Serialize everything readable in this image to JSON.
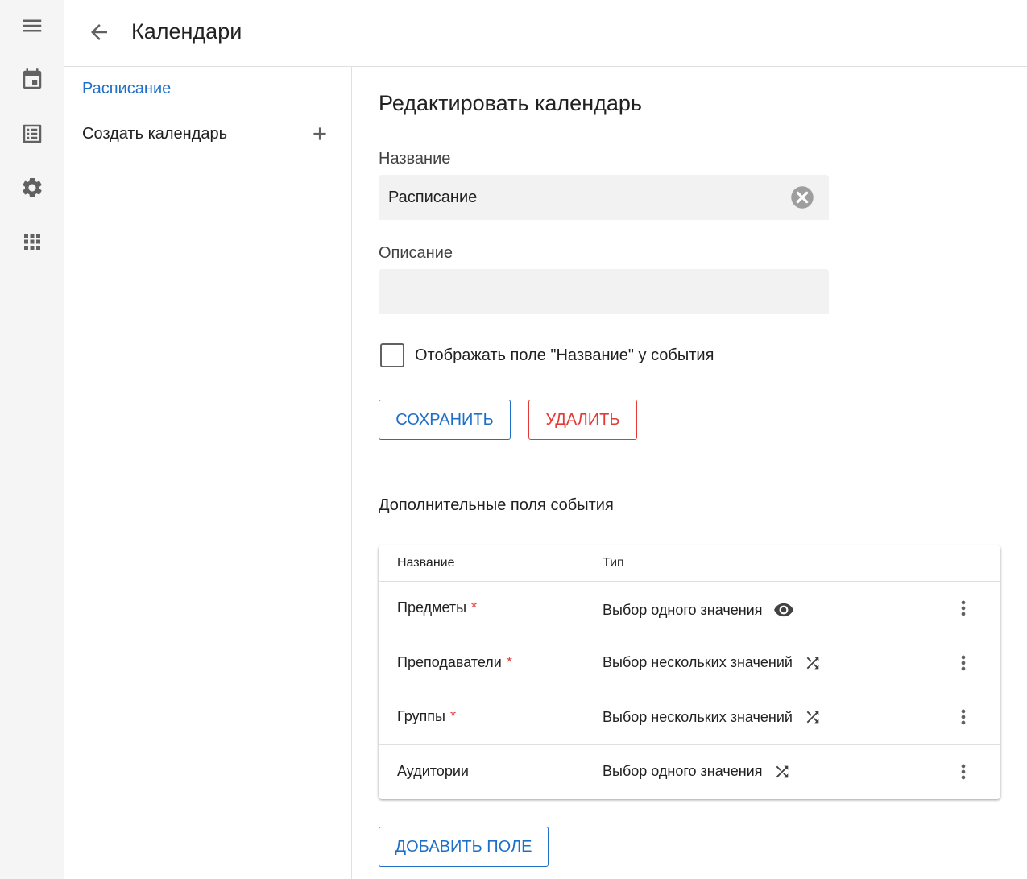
{
  "rail": {
    "items": [
      {
        "name": "menu-icon"
      },
      {
        "name": "calendar-icon"
      },
      {
        "name": "list-icon"
      },
      {
        "name": "gear-icon"
      },
      {
        "name": "apps-grid-icon"
      }
    ]
  },
  "header": {
    "title": "Календари"
  },
  "subnav": {
    "items": [
      {
        "label": "Расписание",
        "active": true
      },
      {
        "label": "Создать календарь"
      }
    ]
  },
  "form": {
    "heading": "Редактировать календарь",
    "name_label": "Название",
    "name_value": "Расписание",
    "description_label": "Описание",
    "description_value": "",
    "checkbox_label": "Отображать поле \"Название\" у события",
    "checkbox_checked": false,
    "save_label": "Сохранить",
    "delete_label": "Удалить"
  },
  "extra_fields": {
    "title": "Дополнительные поля события",
    "columns": [
      "Название",
      "Тип"
    ],
    "rows": [
      {
        "name": "Предметы",
        "required": "*",
        "type": "Выбор одного значения",
        "icon": "eye-icon"
      },
      {
        "name": "Преподаватели",
        "required": "*",
        "type": "Выбор нескольких значений",
        "icon": "shuffle-icon"
      },
      {
        "name": "Группы",
        "required": "*",
        "type": "Выбор нескольких значений",
        "icon": "shuffle-icon"
      },
      {
        "name": "Аудитории",
        "required": "",
        "type": "Выбор одного значения",
        "icon": "shuffle-icon"
      }
    ],
    "add_label": "Добавить поле"
  },
  "colors": {
    "accent": "#1e6fc7",
    "danger": "#e53935",
    "field_bg": "#f2f2f2"
  }
}
